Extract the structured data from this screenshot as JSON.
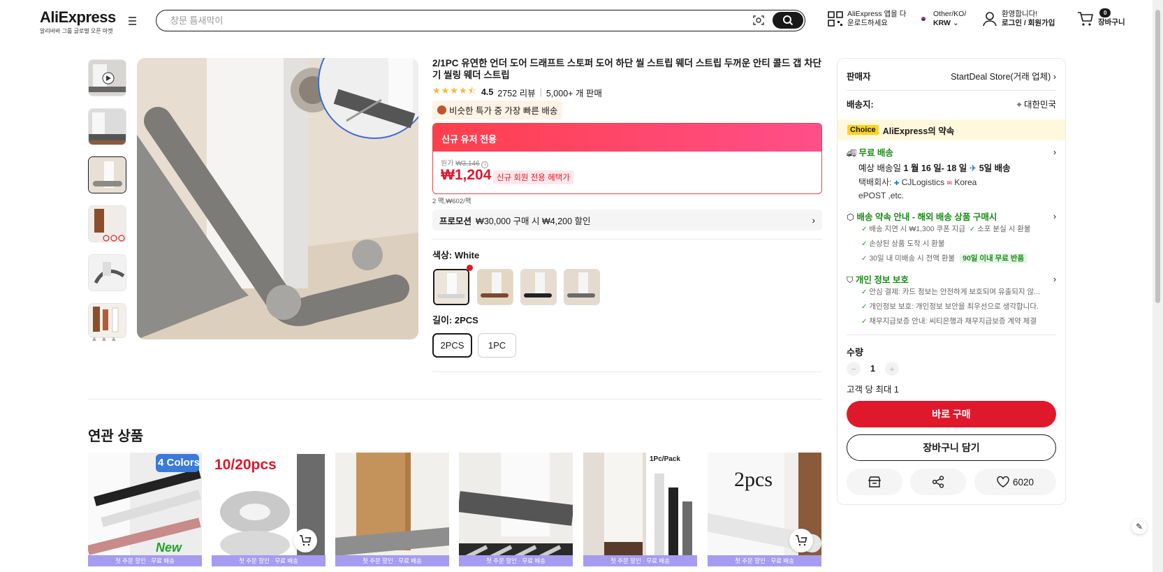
{
  "header": {
    "logo": "AliExpress",
    "logo_sub": "알리바바 그룹 글로벌 오픈 마켓",
    "search_placeholder": "창문 틈새막이",
    "app_line1": "AliExpress 앱을 다",
    "app_line2": "운로드하세요",
    "locale_line1": "Other/KO/",
    "locale_line2": "KRW",
    "user_line1": "환영합니다!",
    "user_line2": "로그인 / 회원가입",
    "cart_count": "0",
    "cart_label": "장바구니"
  },
  "product": {
    "title": "2/1PC 유연한 언더 도어 드래프트 스토퍼 도어 하단 씰 스트립 웨더 스트립 두꺼운 안티 콜드 갭 차단기 씰링 웨더 스트립",
    "rating": "4.5",
    "reviews": "2752 리뷰",
    "sold": "5,000+ 개 판매",
    "fast_badge": "비슷한 특가 중 가장 빠른 배송",
    "new_user_banner": "신규 유저 전용",
    "orig_label": "원가",
    "orig_price": "₩3,146",
    "price": "₩1,204",
    "price_tag": "신규 회원 전용 혜택가",
    "per_piece": "2 팩,₩602/팩",
    "promo_label": "프로모션",
    "promo_text": "₩30,000 구매 시 ₩4,200 할인",
    "color_label": "색상: White",
    "length_label": "길이: 2PCS",
    "lengths": [
      "2PCS",
      "1PC"
    ]
  },
  "related": {
    "title": "연관 상품",
    "strip": "첫 주문 할인 · 무료 배송",
    "card_texts": [
      "4 Colors",
      "10/20pcs",
      "",
      "",
      "1Pc/Pack",
      "2pcs"
    ],
    "badge_new": "New"
  },
  "panel": {
    "seller_label": "판매자",
    "seller_name": "StartDeal Store(거래 업체)",
    "ship_to_label": "배송지:",
    "ship_to": "대한민국",
    "choice_tag": "Choice",
    "choice_text": "AliExpress의 약속",
    "free_ship": "무료 배송",
    "eta_prefix": "예상 배송일",
    "eta_dates": "1 월 16 일- 18 일",
    "eta_fast": "5일 배송",
    "courier_prefix": "택배회사:",
    "courier1": "CJLogistics",
    "courier2": "Korea",
    "courier3": "ePOST ,etc.",
    "promise_title": "배송 약속 안내 - 해외 배송 상품 구매시",
    "promise_items": [
      "배송 지연 시 ₩1,300 쿠폰 지급",
      "소포 분실 시 환불",
      "손상된 상품 도착 시 환불",
      "30일 내 미배송 시 전액 환불"
    ],
    "return_badge": "90일 이내 무료 반품",
    "privacy_title": "개인 정보 보호",
    "privacy_items": [
      "안심 결제: 카드 정보는 안전하게 보호되며 유출되지 않...",
      "개인정보 보호: 개인정보 보안을 최우선으로 생각합니다.",
      "채무지급보증 안내: 씨티은행과 채무지급보증 계약 체결"
    ],
    "qty_label": "수량",
    "qty": "1",
    "max_label": "고객 당 최대 1",
    "buy_label": "바로 구매",
    "cart_label": "장바구니 담기",
    "wish_count": "6020"
  },
  "colors": {
    "brand_red": "#e0182c",
    "choice_yellow": "#fdd31f",
    "green": "#1b8a1b"
  }
}
